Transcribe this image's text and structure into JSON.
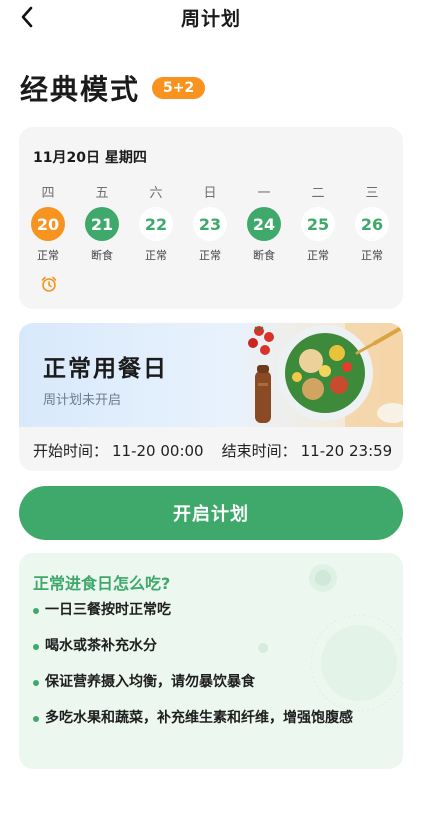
{
  "header": {
    "title": "周计划",
    "back_icon": "chevron-left-icon"
  },
  "mode": {
    "title": "经典模式",
    "badge": "5+2"
  },
  "week": {
    "date_label": "11月20日 星期四",
    "days": [
      {
        "weekday": "四",
        "date": "20",
        "type": "正常",
        "style": "today"
      },
      {
        "weekday": "五",
        "date": "21",
        "type": "断食",
        "style": "fast"
      },
      {
        "weekday": "六",
        "date": "22",
        "type": "正常",
        "style": "normal"
      },
      {
        "weekday": "日",
        "date": "23",
        "type": "正常",
        "style": "normal"
      },
      {
        "weekday": "一",
        "date": "24",
        "type": "断食",
        "style": "fast"
      },
      {
        "weekday": "二",
        "date": "25",
        "type": "正常",
        "style": "normal"
      },
      {
        "weekday": "三",
        "date": "26",
        "type": "正常",
        "style": "normal"
      }
    ],
    "alarm_icon": "alarm-clock-icon"
  },
  "meal": {
    "title": "正常用餐日",
    "subtitle": "周计划未开启",
    "start_label": "开始时间：",
    "start_value": "11-20 00:00",
    "end_label": "结束时间：",
    "end_value": "11-20 23:59"
  },
  "action": {
    "start_plan": "开启计划"
  },
  "tips": {
    "title": "正常进食日怎么吃?",
    "items": [
      "一日三餐按时正常吃",
      "喝水或茶补充水分",
      "保证营养摄入均衡，请勿暴饮暴食",
      "多吃水果和蔬菜，补充维生素和纤维，增强饱腹感"
    ]
  },
  "colors": {
    "accent_green": "#3fa96b",
    "accent_orange": "#f7931e"
  }
}
